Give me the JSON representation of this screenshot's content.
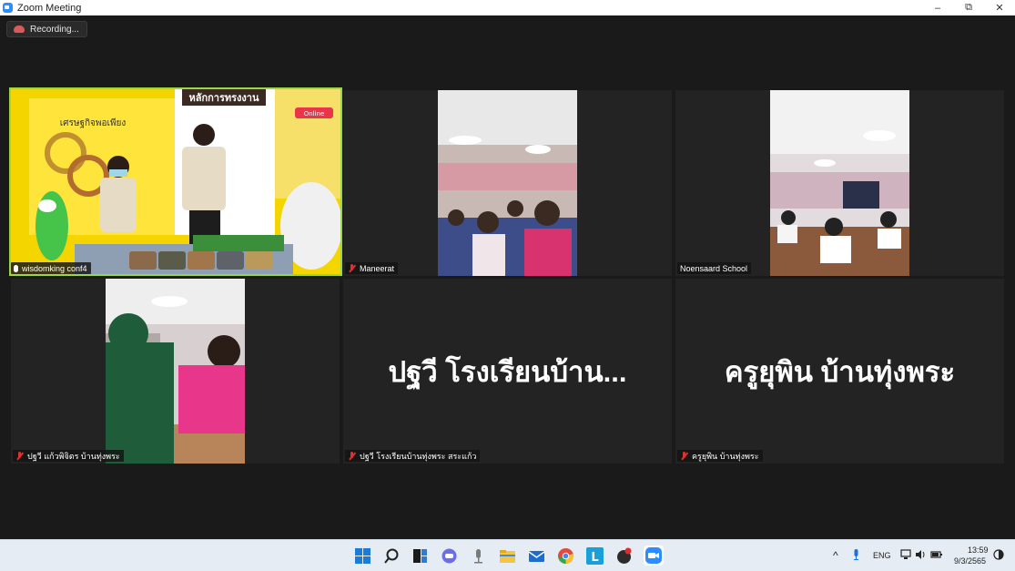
{
  "window": {
    "title": "Zoom Meeting",
    "controls": {
      "minimize": "–",
      "restore": "⧉",
      "close": "✕"
    }
  },
  "recording": {
    "label": "Recording..."
  },
  "participants": [
    {
      "name": "wisdomking conf4",
      "muted": false,
      "active": true
    },
    {
      "name": "Maneerat",
      "muted": true
    },
    {
      "name": "Noensaard School",
      "muted": false
    },
    {
      "name": "ปฐวี แก้วพิจิตร บ้านทุ่งพระ",
      "muted": true
    },
    {
      "name": "ปฐวี โรงเรียนบ้านทุ่งพระ สระแก้ว",
      "muted": true,
      "display_name": "ปฐวี โรงเรียนบ้าน..."
    },
    {
      "name": "ครูยุพิน บ้านทุ่งพระ",
      "muted": true,
      "display_name": "ครูยุพิน บ้านทุ่งพระ"
    }
  ],
  "presentation": {
    "header": "หลักการทรงงาน",
    "subheader": "เศรษฐกิจพอเพียง",
    "badge": "Online"
  },
  "taskbar": {
    "apps": [
      "windows-start",
      "search",
      "task-view",
      "teams-chat",
      "microphone-app",
      "file-explorer",
      "mail",
      "chrome",
      "l-app",
      "app-with-notification",
      "zoom"
    ],
    "tray": {
      "language": "ENG",
      "time": "13:59",
      "date": "9/3/2565"
    }
  }
}
